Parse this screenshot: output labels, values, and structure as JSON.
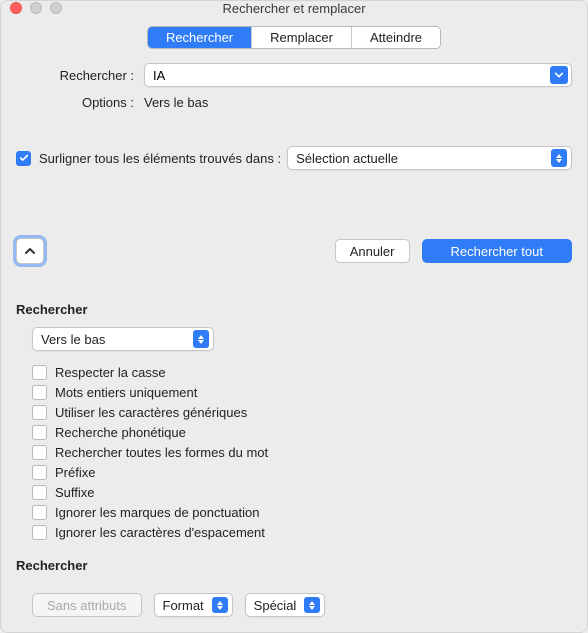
{
  "window": {
    "title": "Rechercher et remplacer"
  },
  "tabs": {
    "search": "Rechercher",
    "replace": "Remplacer",
    "goto": "Atteindre"
  },
  "form": {
    "search_label": "Rechercher :",
    "search_value": "IA",
    "options_label": "Options :",
    "options_value": "Vers le bas"
  },
  "highlight": {
    "checked": true,
    "label": "Surligner tous les éléments trouvés dans :",
    "scope": "Sélection actuelle"
  },
  "actions": {
    "cancel": "Annuler",
    "search_all": "Rechercher tout"
  },
  "options": {
    "section_title": "Rechercher",
    "direction": "Vers le bas",
    "checks": [
      {
        "label": "Respecter la casse",
        "checked": false
      },
      {
        "label": "Mots entiers uniquement",
        "checked": false
      },
      {
        "label": "Utiliser les caractères génériques",
        "checked": false
      },
      {
        "label": "Recherche phonétique",
        "checked": false
      },
      {
        "label": "Rechercher toutes les formes du mot",
        "checked": false
      },
      {
        "label": "Préfixe",
        "checked": false
      },
      {
        "label": "Suffixe",
        "checked": false
      },
      {
        "label": "Ignorer les marques de ponctuation",
        "checked": false
      },
      {
        "label": "Ignorer les caractères d'espacement",
        "checked": false
      }
    ]
  },
  "bottom": {
    "section_title": "Rechercher",
    "no_attributes": "Sans attributs",
    "format": "Format",
    "special": "Spécial"
  }
}
